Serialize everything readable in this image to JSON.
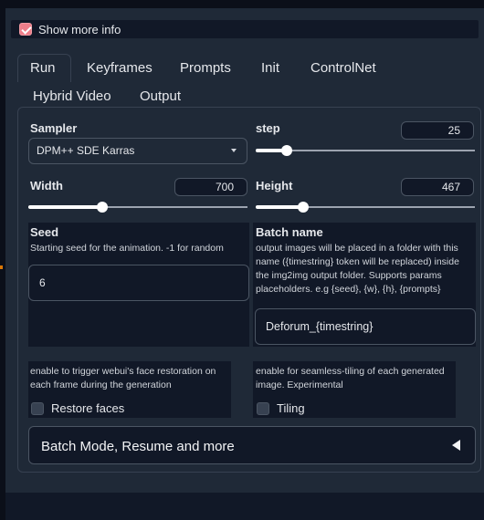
{
  "show_more_info": {
    "label": "Show more info",
    "checked": true
  },
  "tabs": [
    {
      "label": "Run",
      "active": true
    },
    {
      "label": "Keyframes"
    },
    {
      "label": "Prompts"
    },
    {
      "label": "Init"
    },
    {
      "label": "ControlNet"
    },
    {
      "label": "Hybrid Video"
    },
    {
      "label": "Output"
    }
  ],
  "sampler": {
    "label": "Sampler",
    "value": "DPM++ SDE Karras"
  },
  "step": {
    "label": "step",
    "value": "25",
    "fraction": 0.15
  },
  "width": {
    "label": "Width",
    "value": "700",
    "fraction": 0.33
  },
  "height": {
    "label": "Height",
    "value": "467",
    "fraction": 0.22
  },
  "seed": {
    "label": "Seed",
    "description": "Starting seed for the animation. -1 for random",
    "value": "6"
  },
  "batch_name": {
    "label": "Batch name",
    "description": "output images will be placed in a folder with this name ({timestring} token will be replaced) inside the img2img output folder. Supports params placeholders. e.g {seed}, {w}, {h}, {prompts}",
    "value": "Deforum_{timestring}"
  },
  "restore_faces": {
    "description": "enable to trigger webui's face restoration on each frame during the generation",
    "label": "Restore faces",
    "checked": false
  },
  "tiling": {
    "description": "enable for seamless-tiling of each generated image. Experimental",
    "label": "Tiling",
    "checked": false
  },
  "accordion": {
    "label": "Batch Mode, Resume and more",
    "icon": "triangle-left-icon"
  },
  "colors": {
    "accent": "#ef7e8a",
    "background": "#1f2937",
    "dark": "#111827"
  }
}
